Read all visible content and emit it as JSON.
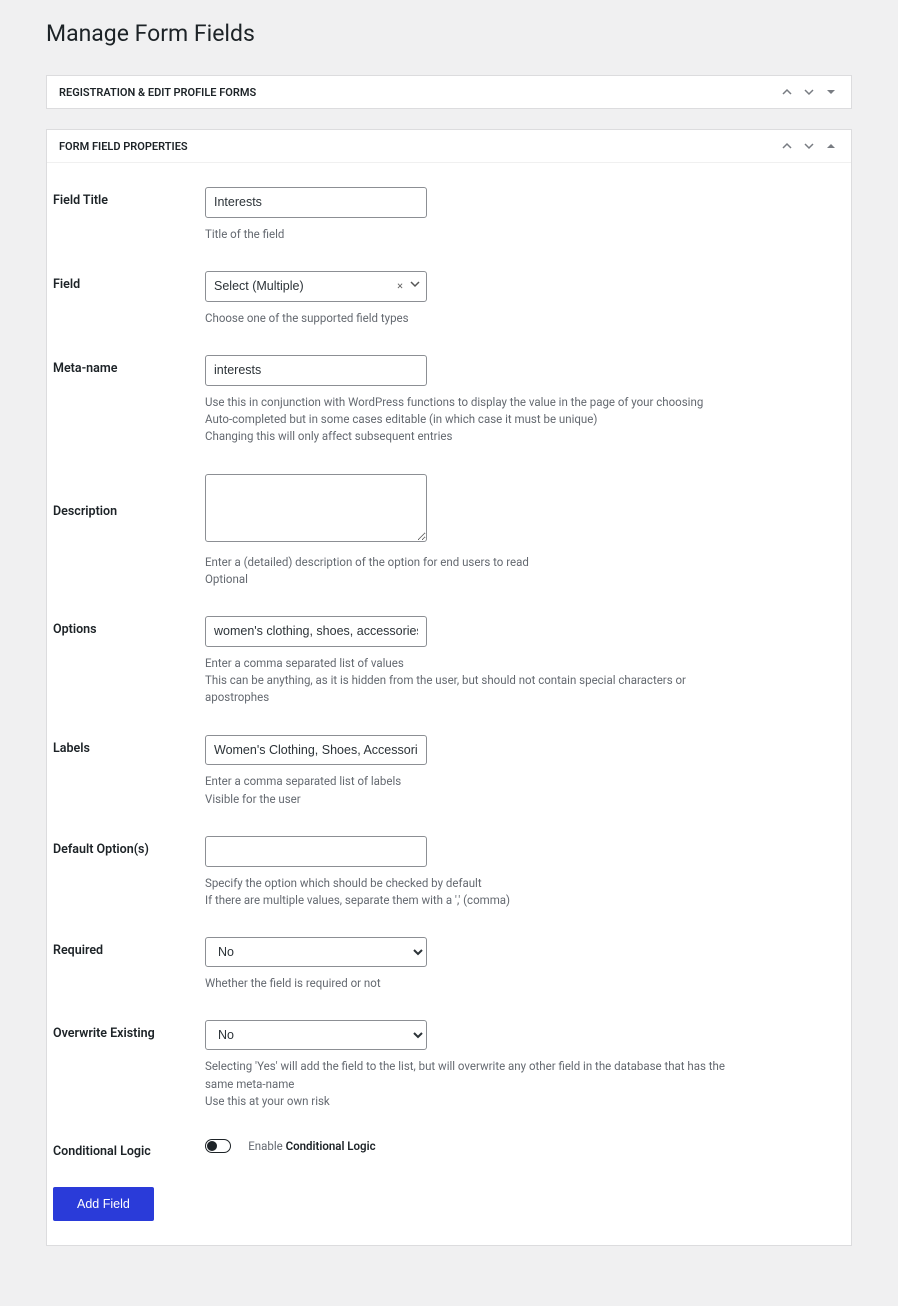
{
  "pageTitle": "Manage Form Fields",
  "panels": {
    "registration": {
      "title": "Registration & Edit Profile Forms"
    },
    "properties": {
      "title": "Form Field Properties"
    }
  },
  "fields": {
    "fieldTitle": {
      "label": "Field Title",
      "value": "Interests",
      "help": "Title of the field"
    },
    "field": {
      "label": "Field",
      "value": "Select (Multiple)",
      "help": "Choose one of the supported field types"
    },
    "metaName": {
      "label": "Meta-name",
      "value": "interests",
      "help1": "Use this in conjunction with WordPress functions to display the value in the page of your choosing",
      "help2": "Auto-completed but in some cases editable (in which case it must be unique)",
      "help3": "Changing this will only affect subsequent entries"
    },
    "description": {
      "label": "Description",
      "value": "",
      "help1": "Enter a (detailed) description of the option for end users to read",
      "help2": "Optional"
    },
    "options": {
      "label": "Options",
      "value": "women's clothing, shoes, accessories",
      "help1": "Enter a comma separated list of values",
      "help2": "This can be anything, as it is hidden from the user, but should not contain special characters or apostrophes"
    },
    "labels": {
      "label": "Labels",
      "value": "Women's Clothing, Shoes, Accessories",
      "help1": "Enter a comma separated list of labels",
      "help2": "Visible for the user"
    },
    "defaultOptions": {
      "label": "Default Option(s)",
      "value": "",
      "help1": "Specify the option which should be checked by default",
      "help2": "If there are multiple values, separate them with a ',' (comma)"
    },
    "required": {
      "label": "Required",
      "value": "No",
      "help": "Whether the field is required or not"
    },
    "overwrite": {
      "label": "Overwrite Existing",
      "value": "No",
      "help1": "Selecting 'Yes' will add the field to the list, but will overwrite any other field in the database that has the same meta-name",
      "help2": "Use this at your own risk"
    },
    "conditionalLogic": {
      "label": "Conditional Logic",
      "togglePrefix": "Enable ",
      "toggleStrong": "Conditional Logic"
    }
  },
  "submit": {
    "label": "Add Field"
  }
}
